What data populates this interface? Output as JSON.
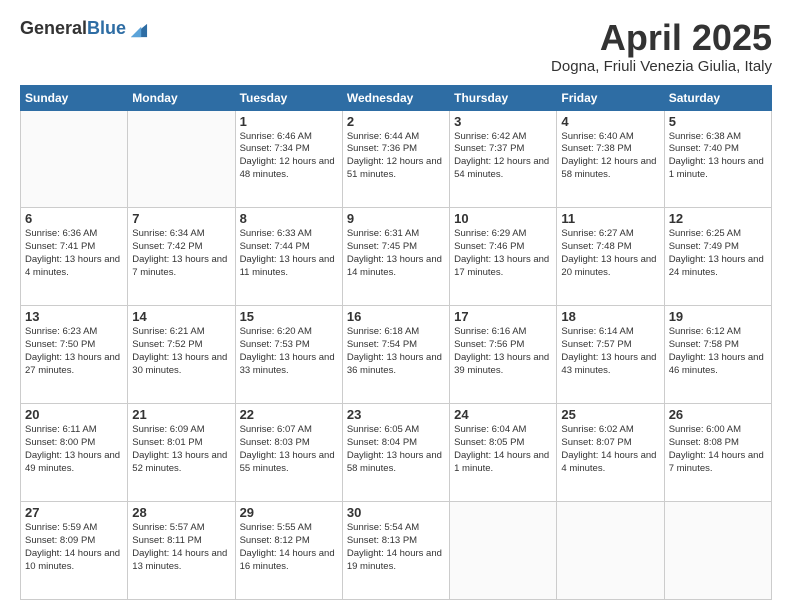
{
  "logo": {
    "general": "General",
    "blue": "Blue"
  },
  "header": {
    "title": "April 2025",
    "subtitle": "Dogna, Friuli Venezia Giulia, Italy"
  },
  "days_of_week": [
    "Sunday",
    "Monday",
    "Tuesday",
    "Wednesday",
    "Thursday",
    "Friday",
    "Saturday"
  ],
  "weeks": [
    [
      {
        "day": "",
        "info": ""
      },
      {
        "day": "",
        "info": ""
      },
      {
        "day": "1",
        "info": "Sunrise: 6:46 AM\nSunset: 7:34 PM\nDaylight: 12 hours and 48 minutes."
      },
      {
        "day": "2",
        "info": "Sunrise: 6:44 AM\nSunset: 7:36 PM\nDaylight: 12 hours and 51 minutes."
      },
      {
        "day": "3",
        "info": "Sunrise: 6:42 AM\nSunset: 7:37 PM\nDaylight: 12 hours and 54 minutes."
      },
      {
        "day": "4",
        "info": "Sunrise: 6:40 AM\nSunset: 7:38 PM\nDaylight: 12 hours and 58 minutes."
      },
      {
        "day": "5",
        "info": "Sunrise: 6:38 AM\nSunset: 7:40 PM\nDaylight: 13 hours and 1 minute."
      }
    ],
    [
      {
        "day": "6",
        "info": "Sunrise: 6:36 AM\nSunset: 7:41 PM\nDaylight: 13 hours and 4 minutes."
      },
      {
        "day": "7",
        "info": "Sunrise: 6:34 AM\nSunset: 7:42 PM\nDaylight: 13 hours and 7 minutes."
      },
      {
        "day": "8",
        "info": "Sunrise: 6:33 AM\nSunset: 7:44 PM\nDaylight: 13 hours and 11 minutes."
      },
      {
        "day": "9",
        "info": "Sunrise: 6:31 AM\nSunset: 7:45 PM\nDaylight: 13 hours and 14 minutes."
      },
      {
        "day": "10",
        "info": "Sunrise: 6:29 AM\nSunset: 7:46 PM\nDaylight: 13 hours and 17 minutes."
      },
      {
        "day": "11",
        "info": "Sunrise: 6:27 AM\nSunset: 7:48 PM\nDaylight: 13 hours and 20 minutes."
      },
      {
        "day": "12",
        "info": "Sunrise: 6:25 AM\nSunset: 7:49 PM\nDaylight: 13 hours and 24 minutes."
      }
    ],
    [
      {
        "day": "13",
        "info": "Sunrise: 6:23 AM\nSunset: 7:50 PM\nDaylight: 13 hours and 27 minutes."
      },
      {
        "day": "14",
        "info": "Sunrise: 6:21 AM\nSunset: 7:52 PM\nDaylight: 13 hours and 30 minutes."
      },
      {
        "day": "15",
        "info": "Sunrise: 6:20 AM\nSunset: 7:53 PM\nDaylight: 13 hours and 33 minutes."
      },
      {
        "day": "16",
        "info": "Sunrise: 6:18 AM\nSunset: 7:54 PM\nDaylight: 13 hours and 36 minutes."
      },
      {
        "day": "17",
        "info": "Sunrise: 6:16 AM\nSunset: 7:56 PM\nDaylight: 13 hours and 39 minutes."
      },
      {
        "day": "18",
        "info": "Sunrise: 6:14 AM\nSunset: 7:57 PM\nDaylight: 13 hours and 43 minutes."
      },
      {
        "day": "19",
        "info": "Sunrise: 6:12 AM\nSunset: 7:58 PM\nDaylight: 13 hours and 46 minutes."
      }
    ],
    [
      {
        "day": "20",
        "info": "Sunrise: 6:11 AM\nSunset: 8:00 PM\nDaylight: 13 hours and 49 minutes."
      },
      {
        "day": "21",
        "info": "Sunrise: 6:09 AM\nSunset: 8:01 PM\nDaylight: 13 hours and 52 minutes."
      },
      {
        "day": "22",
        "info": "Sunrise: 6:07 AM\nSunset: 8:03 PM\nDaylight: 13 hours and 55 minutes."
      },
      {
        "day": "23",
        "info": "Sunrise: 6:05 AM\nSunset: 8:04 PM\nDaylight: 13 hours and 58 minutes."
      },
      {
        "day": "24",
        "info": "Sunrise: 6:04 AM\nSunset: 8:05 PM\nDaylight: 14 hours and 1 minute."
      },
      {
        "day": "25",
        "info": "Sunrise: 6:02 AM\nSunset: 8:07 PM\nDaylight: 14 hours and 4 minutes."
      },
      {
        "day": "26",
        "info": "Sunrise: 6:00 AM\nSunset: 8:08 PM\nDaylight: 14 hours and 7 minutes."
      }
    ],
    [
      {
        "day": "27",
        "info": "Sunrise: 5:59 AM\nSunset: 8:09 PM\nDaylight: 14 hours and 10 minutes."
      },
      {
        "day": "28",
        "info": "Sunrise: 5:57 AM\nSunset: 8:11 PM\nDaylight: 14 hours and 13 minutes."
      },
      {
        "day": "29",
        "info": "Sunrise: 5:55 AM\nSunset: 8:12 PM\nDaylight: 14 hours and 16 minutes."
      },
      {
        "day": "30",
        "info": "Sunrise: 5:54 AM\nSunset: 8:13 PM\nDaylight: 14 hours and 19 minutes."
      },
      {
        "day": "",
        "info": ""
      },
      {
        "day": "",
        "info": ""
      },
      {
        "day": "",
        "info": ""
      }
    ]
  ]
}
